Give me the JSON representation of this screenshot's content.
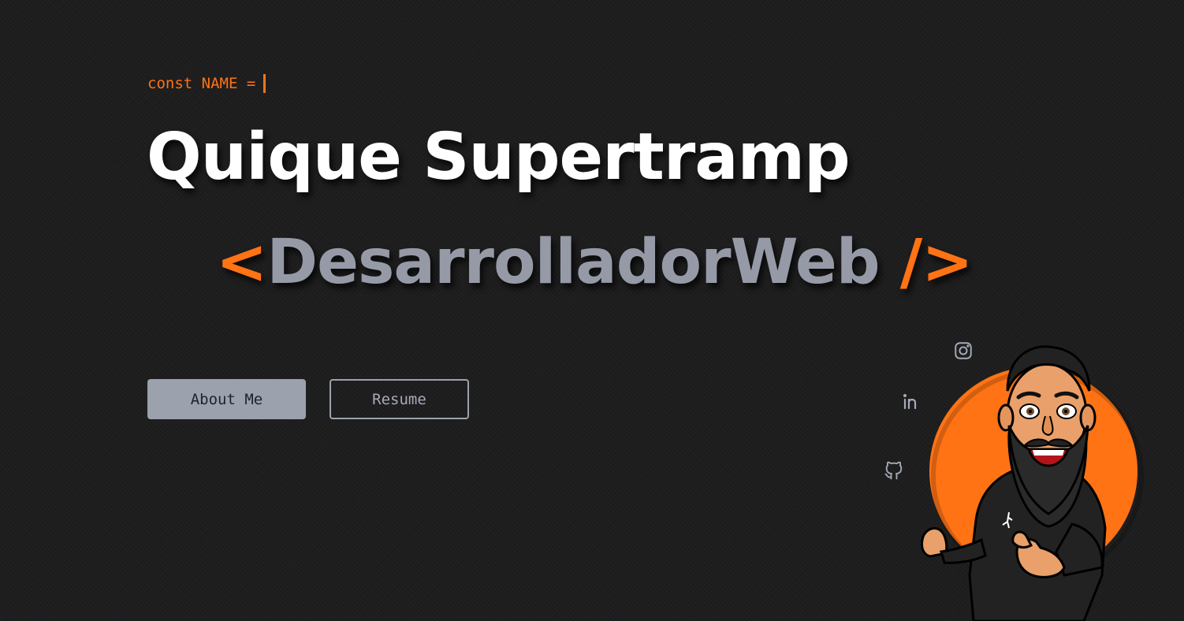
{
  "header": {
    "code_prefix": "const NAME ="
  },
  "hero": {
    "name": "Quique Supertramp",
    "role_open": "<",
    "role_word": "DesarrolladorWeb",
    "role_close": " />"
  },
  "buttons": {
    "about_label": "About Me",
    "resume_label": "Resume"
  },
  "social": {
    "icons": [
      "instagram-icon",
      "linkedin-icon",
      "github-icon"
    ]
  },
  "colors": {
    "background": "#1e1e1f",
    "accent": "#ff7314",
    "muted": "#959aa6",
    "title": "#ffffff"
  }
}
